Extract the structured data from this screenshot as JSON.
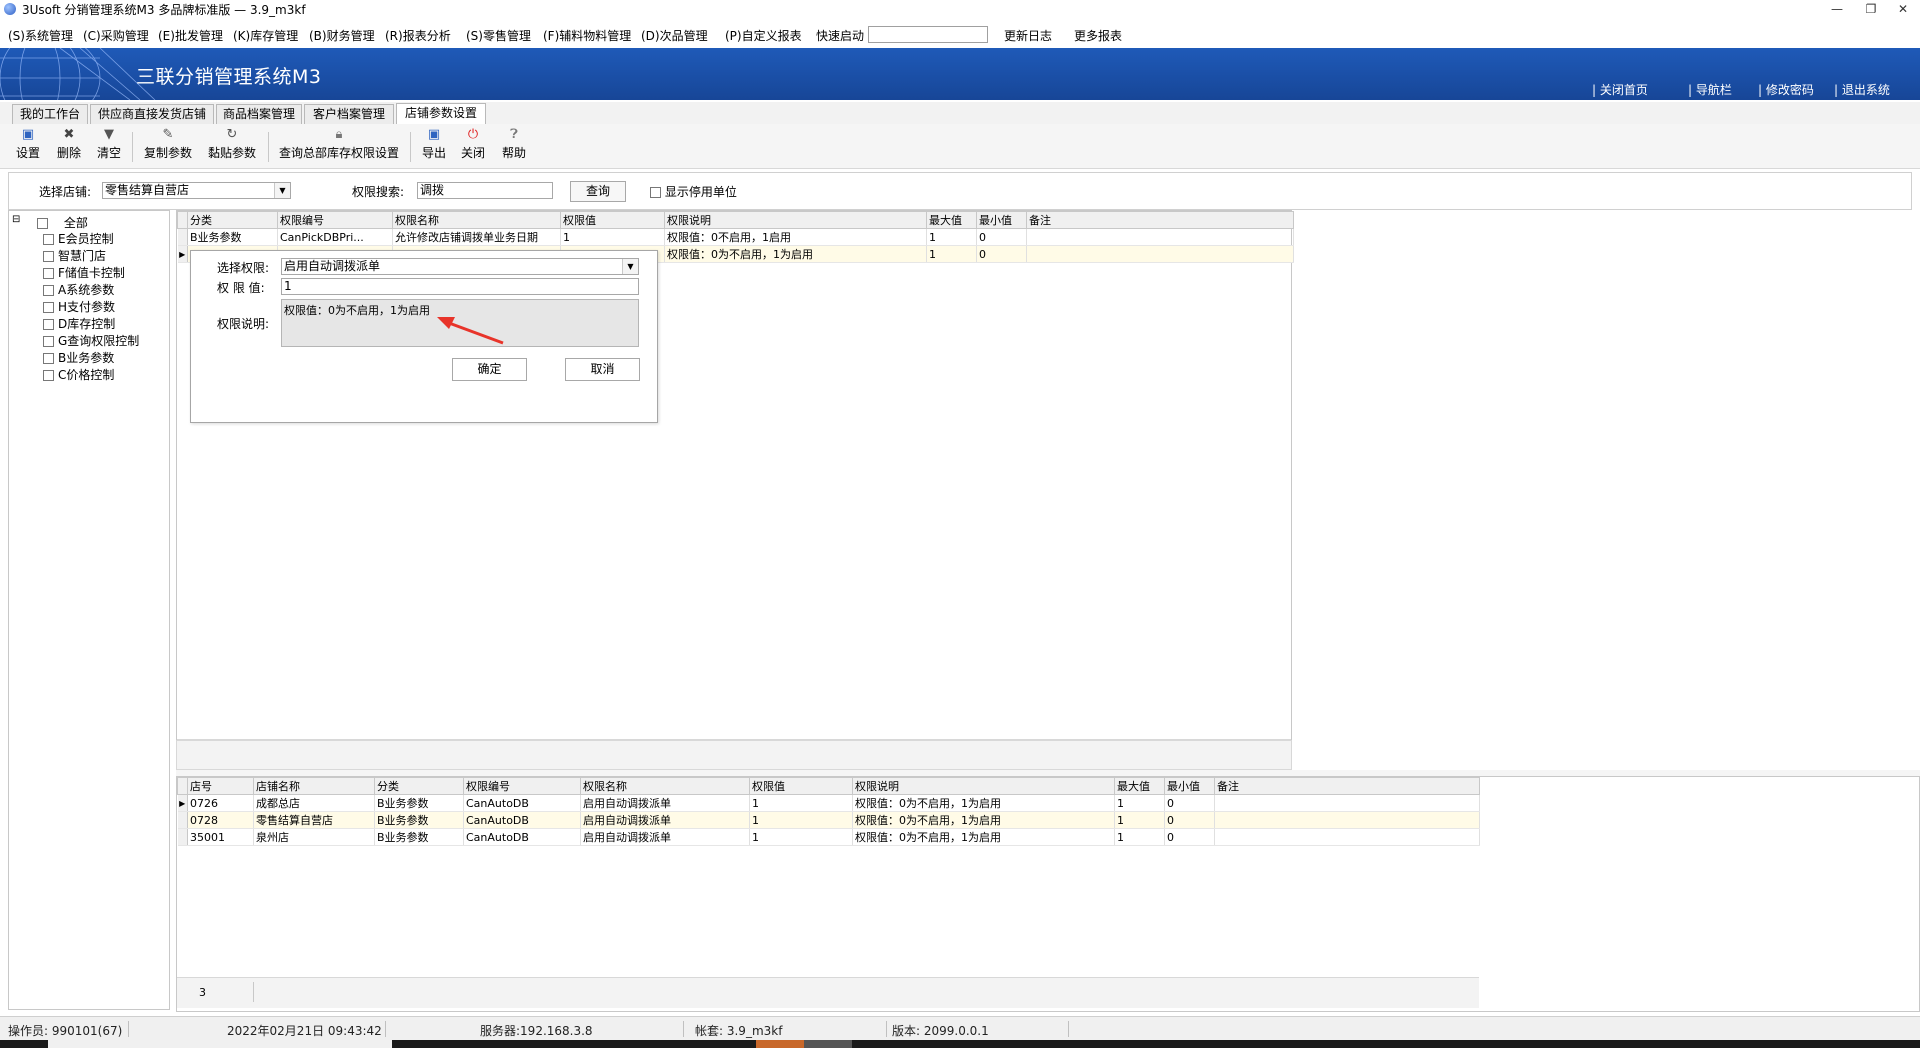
{
  "window": {
    "title": "3Usoft 分销管理系统M3 多品牌标准版 — 3.9_m3kf",
    "min_glyph": "—",
    "restore_glyph": "❐",
    "close_glyph": "✕"
  },
  "menu": {
    "items": [
      "(S)系统管理",
      "(C)采购管理",
      "(E)批发管理",
      "(K)库存管理",
      "(B)财务管理",
      "(R)报表分析",
      "(S)零售管理",
      "(F)辅料物料管理",
      "(D)次品管理",
      "(P)自定义报表"
    ],
    "quick_label": "快速启动",
    "quick_value": "",
    "update_log": "更新日志",
    "more_reports": "更多报表"
  },
  "banner": {
    "app_title": "三联分销管理系统M3",
    "links": [
      "| 关闭首页",
      "| 导航栏",
      "| 修改密码",
      "| 退出系统"
    ]
  },
  "tabs": [
    "我的工作台",
    "供应商直接发货店铺",
    "商品档案管理",
    "客户档案管理",
    "店铺参数设置"
  ],
  "toolbar": {
    "buttons": [
      "设置",
      "删除",
      "清空",
      "复制参数",
      "黏贴参数",
      "查询总部库存权限设置",
      "导出",
      "关闭",
      "帮助"
    ]
  },
  "filter": {
    "store_label": "选择店铺:",
    "store_value": "零售结算自营店",
    "search_label": "权限搜索:",
    "search_value": "调拨",
    "query_button": "查询",
    "show_disabled_label": "显示停用单位"
  },
  "tree": {
    "root": "全部",
    "items": [
      "E会员控制",
      "智慧门店",
      "F储值卡控制",
      "A系统参数",
      "H支付参数",
      "D库存控制",
      "G查询权限控制",
      "B业务参数",
      "C价格控制"
    ]
  },
  "top_grid": {
    "columns": [
      "分类",
      "权限编号",
      "权限名称",
      "权限值",
      "权限说明",
      "最大值",
      "最小值",
      "备注"
    ],
    "rows": [
      [
        "B业务参数",
        "CanPickDBPri...",
        "允许修改店铺调拨单业务日期",
        "1",
        "权限值：0不启用，1启用",
        "1",
        "0",
        ""
      ],
      [
        "",
        "",
        "",
        "",
        "权限值：0为不启用，1为启用",
        "1",
        "0",
        ""
      ]
    ]
  },
  "dialog": {
    "select_label": "选择权限:",
    "select_value": "启用自动调拨派单",
    "value_label": "权 限 值:",
    "value_value": "1",
    "desc_label": "权限说明:",
    "desc_text": "权限值：0为不启用，1为启用",
    "ok_button": "确定",
    "cancel_button": "取消"
  },
  "bottom_grid": {
    "columns": [
      "店号",
      "店铺名称",
      "分类",
      "权限编号",
      "权限名称",
      "权限值",
      "权限说明",
      "最大值",
      "最小值",
      "备注"
    ],
    "rows": [
      [
        "0726",
        "成都总店",
        "B业务参数",
        "CanAutoDB",
        "启用自动调拨派单",
        "1",
        "权限值：0为不启用，1为启用",
        "1",
        "0",
        ""
      ],
      [
        "0728",
        "零售结算自营店",
        "B业务参数",
        "CanAutoDB",
        "启用自动调拨派单",
        "1",
        "权限值：0为不启用，1为启用",
        "1",
        "0",
        ""
      ],
      [
        "35001",
        "泉州店",
        "B业务参数",
        "CanAutoDB",
        "启用自动调拨派单",
        "1",
        "权限值：0为不启用，1为启用",
        "1",
        "0",
        ""
      ]
    ],
    "footer_count": "3"
  },
  "status": {
    "operator": "操作员: 990101(67)",
    "datetime": "2022年02月21日 09:43:42",
    "server": "服务器:192.168.3.8",
    "account": "帐套: 3.9_m3kf",
    "version": "版本: 2099.0.0.1"
  },
  "colors": {
    "banner_blue": "#1a4ea5",
    "annotation_red": "#e8342a",
    "alt_row": "#fffbe7"
  }
}
